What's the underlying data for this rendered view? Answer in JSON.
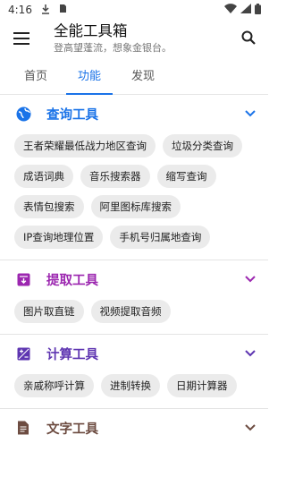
{
  "status": {
    "time": "4:16"
  },
  "app": {
    "title": "全能工具箱",
    "subtitle": "登高望蓬流，想象金银台。"
  },
  "tabs": [
    {
      "label": "首页",
      "active": false
    },
    {
      "label": "功能",
      "active": true
    },
    {
      "label": "发现",
      "active": false
    }
  ],
  "sections": [
    {
      "title": "查询工具",
      "color": "#1a73e8",
      "icon": "globe-icon",
      "items": [
        "王者荣耀最低战力地区查询",
        "垃圾分类查询",
        "成语词典",
        "音乐搜索器",
        "缩写查询",
        "表情包搜索",
        "阿里图标库搜索",
        "IP查询地理位置",
        "手机号归属地查询"
      ]
    },
    {
      "title": "提取工具",
      "color": "#9c27b0",
      "icon": "archive-download-icon",
      "items": [
        "图片取直链",
        "视频提取音频"
      ]
    },
    {
      "title": "计算工具",
      "color": "#5e35b1",
      "icon": "calculator-icon",
      "items": [
        "亲戚称呼计算",
        "进制转换",
        "日期计算器"
      ]
    },
    {
      "title": "文字工具",
      "color": "#6d4c41",
      "icon": "document-icon",
      "items": []
    }
  ]
}
